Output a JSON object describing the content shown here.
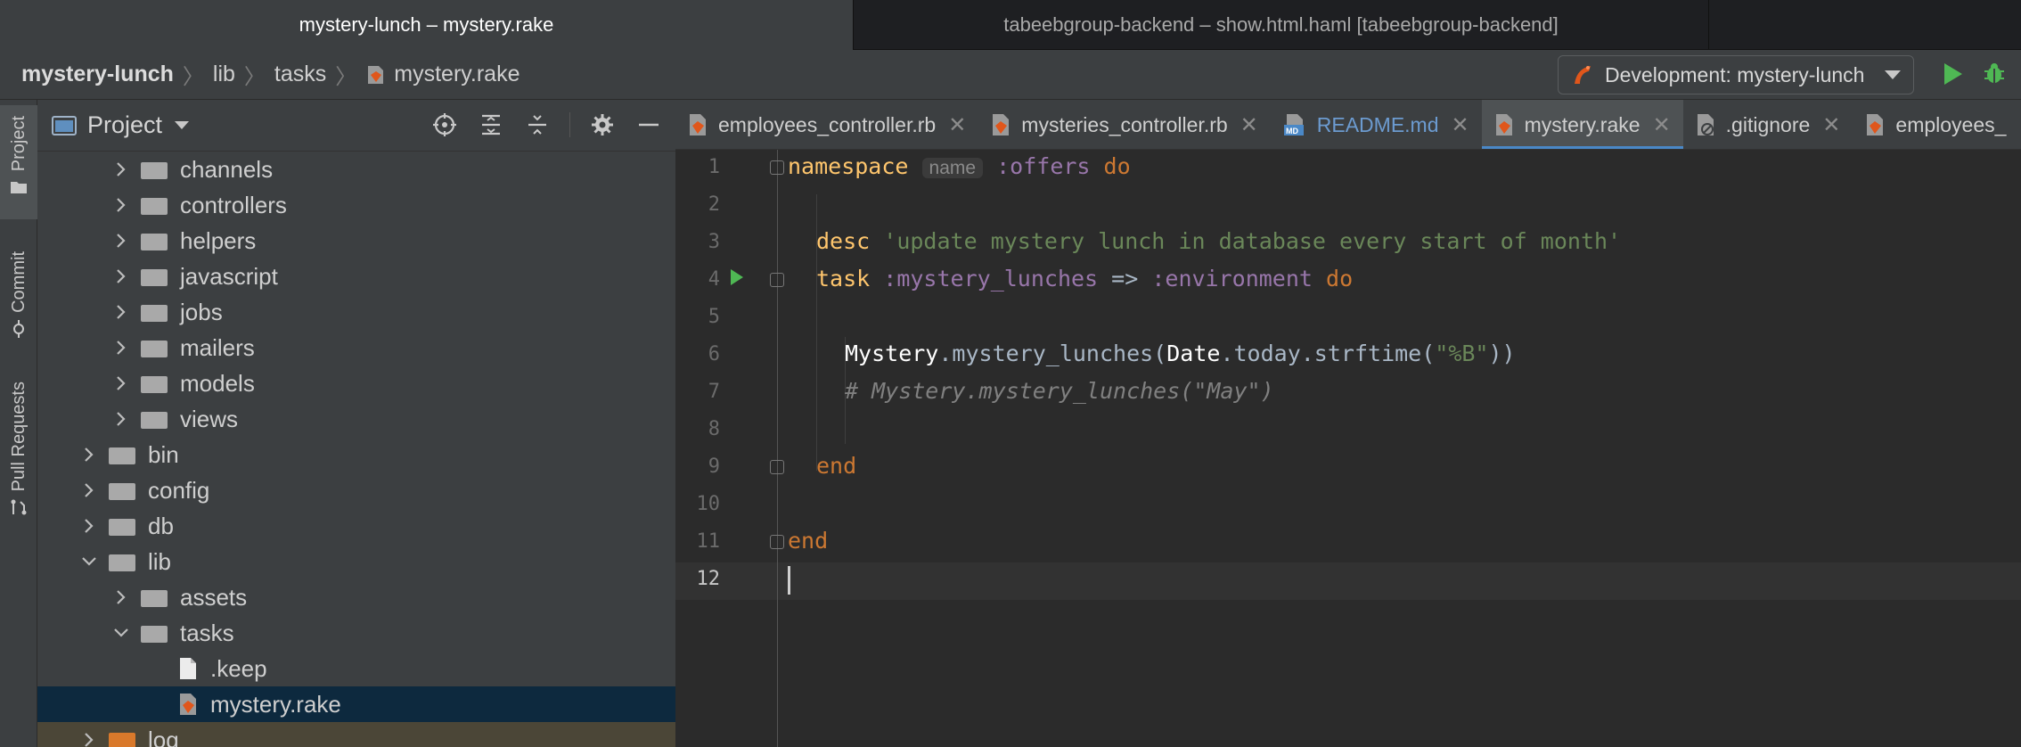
{
  "window_tabs": [
    {
      "label": "mystery-lunch – mystery.rake",
      "active": true
    },
    {
      "label": "tabeebgroup-backend – show.html.haml [tabeebgroup-backend]",
      "active": false
    }
  ],
  "breadcrumb": {
    "root": "mystery-lunch",
    "dir1": "lib",
    "dir2": "tasks",
    "file": "mystery.rake"
  },
  "run_config": {
    "label": "Development: mystery-lunch"
  },
  "tool_strip": {
    "project": "Project",
    "commit": "Commit",
    "pull_requests": "Pull Requests"
  },
  "project_panel": {
    "title": "Project"
  },
  "tree": [
    {
      "label": "channels",
      "type": "folder",
      "expanded": false
    },
    {
      "label": "controllers",
      "type": "folder",
      "expanded": false
    },
    {
      "label": "helpers",
      "type": "folder",
      "expanded": false
    },
    {
      "label": "javascript",
      "type": "folder",
      "expanded": false
    },
    {
      "label": "jobs",
      "type": "folder",
      "expanded": false
    },
    {
      "label": "mailers",
      "type": "folder",
      "expanded": false
    },
    {
      "label": "models",
      "type": "folder",
      "expanded": false
    },
    {
      "label": "views",
      "type": "folder",
      "expanded": false
    },
    {
      "label": "bin",
      "type": "folder",
      "expanded": false
    },
    {
      "label": "config",
      "type": "folder",
      "expanded": false
    },
    {
      "label": "db",
      "type": "folder",
      "expanded": false
    },
    {
      "label": "lib",
      "type": "folder",
      "expanded": true
    },
    {
      "label": "assets",
      "type": "folder",
      "expanded": false
    },
    {
      "label": "tasks",
      "type": "folder",
      "expanded": true
    },
    {
      "label": ".keep",
      "type": "file"
    },
    {
      "label": "mystery.rake",
      "type": "rake",
      "selected": true
    },
    {
      "label": "log",
      "type": "folder",
      "expanded": false
    }
  ],
  "editor_tabs": [
    {
      "label": "employees_controller.rb",
      "icon": "ruby-icon",
      "active": false
    },
    {
      "label": "mysteries_controller.rb",
      "icon": "ruby-icon",
      "active": false
    },
    {
      "label": "README.md",
      "icon": "markdown-icon",
      "active": false
    },
    {
      "label": "mystery.rake",
      "icon": "ruby-icon",
      "active": true
    },
    {
      "label": ".gitignore",
      "icon": "gitignore-icon",
      "active": false
    },
    {
      "label": "employees_",
      "icon": "ruby-icon",
      "active": false
    }
  ],
  "code": {
    "line_numbers": [
      "1",
      "2",
      "3",
      "4",
      "5",
      "6",
      "7",
      "8",
      "9",
      "10",
      "11",
      "12"
    ],
    "l1_kw": "namespace",
    "l1_hint": "name",
    "l1_sym": ":offers",
    "l1_do": "do",
    "l3_desc": "desc",
    "l3_str": "'update mystery lunch in database every start of month'",
    "l4_task": "task",
    "l4_sym": ":mystery_lunches",
    "l4_arrow": "=>",
    "l4_env": ":environment",
    "l4_do": "do",
    "l6_class": "Mystery",
    "l6_method": ".mystery_lunches(",
    "l6_date": "Date",
    "l6_call": ".today.strftime(",
    "l6_str": "\"%B\"",
    "l6_close": "))",
    "l7_comment": "# Mystery.mystery_lunches(\"May\")",
    "l9_end": "end",
    "l11_end": "end"
  },
  "colors": {
    "accent": "#4a88c7",
    "keyword": "#cc7832",
    "symbol": "#9876aa",
    "string": "#6a8759",
    "run": "#4fb854",
    "ruby": "#e0561b"
  }
}
